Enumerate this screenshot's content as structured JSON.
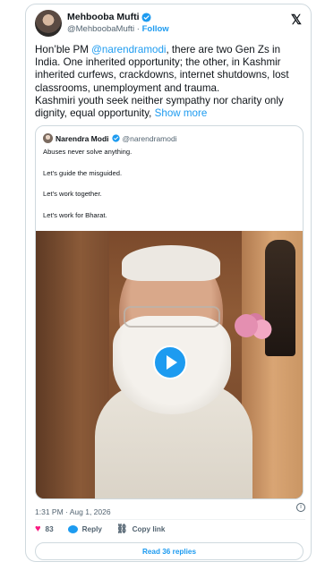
{
  "tweet": {
    "author_name": "Mehbooba Mufti",
    "author_handle": "@MehboobaMufti",
    "separator": " · ",
    "follow_label": "Follow",
    "text_prefix": "Hon’ble PM ",
    "mention": "@narendramodi",
    "text_body": ", there are two Gen Zs in India. One inherited opportunity; the other, in Kashmir inherited curfews, crackdowns, internet shutdowns, lost classrooms, unemployment and trauma.",
    "text_line2": "Kashmiri youth seek neither sympathy nor charity only dignity, equal opportunity, ",
    "show_more": "Show more",
    "timestamp": "1:31 PM · Aug 1, 2026",
    "like_count": "83",
    "reply_label": "Reply",
    "copy_link_label": "Copy link",
    "read_replies_label": "Read 36 replies"
  },
  "quote": {
    "author_name": "Narendra Modi",
    "author_handle": "@narendramodi",
    "lines": [
      "Abuses never solve anything.",
      "Let’s guide the misguided.",
      "Let’s work together.",
      "Let’s work for Bharat."
    ]
  },
  "icons": {
    "x_logo": "x-logo-icon",
    "verified": "verified-badge-icon",
    "play": "play-icon",
    "heart": "heart-icon",
    "reply": "reply-icon",
    "link": "link-icon",
    "info": "info-icon"
  },
  "colors": {
    "accent": "#1d9bf0",
    "like": "#f91880",
    "text": "#0f1419",
    "secondary": "#536471",
    "border": "#cfd9de"
  }
}
